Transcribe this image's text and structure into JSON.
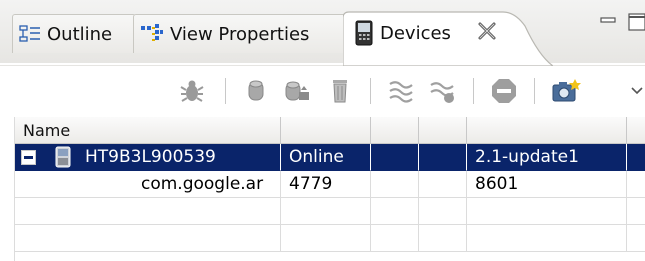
{
  "tabs": [
    {
      "label": "Outline",
      "icon": "outline-icon"
    },
    {
      "label": "View Properties",
      "icon": "view-properties-icon"
    },
    {
      "label": "Devices",
      "icon": "phone-device-icon"
    }
  ],
  "window_controls": {
    "minimize": "minimize-icon",
    "maximize": "maximize-icon",
    "view_menu": "view-menu-chevron-icon"
  },
  "toolbar": {
    "buttons": [
      {
        "name": "debug-process-button",
        "icon": "bug-icon"
      },
      {
        "name": "update-heap-button",
        "icon": "heap-cylinder-icon"
      },
      {
        "name": "dump-hprof-button",
        "icon": "hprof-dump-icon"
      },
      {
        "name": "cause-gc-button",
        "icon": "trash-can-icon"
      },
      {
        "name": "update-threads-button",
        "icon": "threads-icon"
      },
      {
        "name": "start-method-profiling-button",
        "icon": "method-profiling-icon"
      },
      {
        "name": "stop-process-button",
        "icon": "stop-sign-icon"
      },
      {
        "name": "screen-capture-button",
        "icon": "camera-icon"
      }
    ]
  },
  "table": {
    "columns": [
      "Name",
      "",
      "",
      "",
      "",
      ""
    ],
    "rows": [
      {
        "expander": "collapse-minus-icon",
        "device_icon": "phone-device-icon",
        "cells": [
          "HT9B3L900539",
          "Online",
          "",
          "",
          "2.1-update1"
        ],
        "selected": true
      },
      {
        "cells": [
          "com.google.ar",
          "4779",
          "",
          "",
          "8601"
        ],
        "selected": false
      },
      {
        "cells": [
          "",
          "",
          "",
          "",
          ""
        ],
        "selected": false
      },
      {
        "cells": [
          "",
          "",
          "",
          "",
          ""
        ],
        "selected": false
      }
    ]
  },
  "colors": {
    "selection": "#0a246a",
    "selection_text": "#ffffff",
    "tab_bg": "#ecebe8",
    "active_tab_bg": "#ffffff"
  }
}
